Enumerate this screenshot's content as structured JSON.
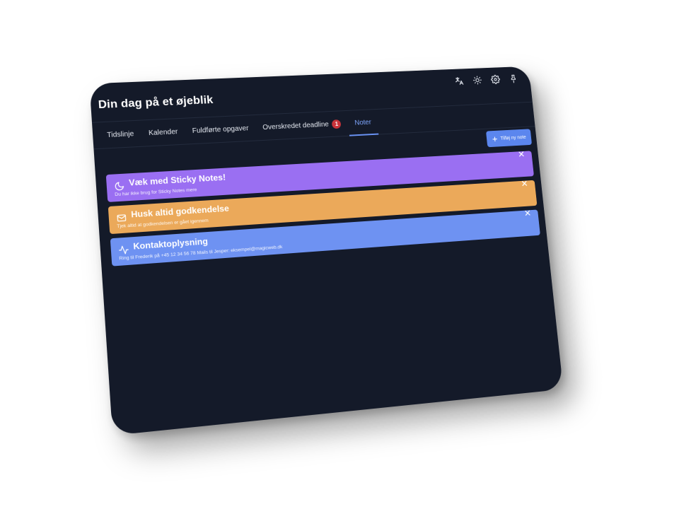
{
  "app": {
    "title": "Din dag på et øjeblik"
  },
  "header_icons": [
    {
      "name": "translate-icon"
    },
    {
      "name": "theme-toggle-icon"
    },
    {
      "name": "settings-icon"
    },
    {
      "name": "pin-icon"
    }
  ],
  "tabs": [
    {
      "label": "Tidslinje",
      "active": false
    },
    {
      "label": "Kalender",
      "active": false
    },
    {
      "label": "Fuldførte opgaver",
      "active": false
    },
    {
      "label": "Overskredet deadline",
      "active": false,
      "badge": "1"
    },
    {
      "label": "Noter",
      "active": true
    }
  ],
  "toolbar": {
    "add_note_label": "Tilføj ny note"
  },
  "notes": [
    {
      "title": "Væk med Sticky Notes!",
      "text": "Du har ikke brug for Sticky Notes mere",
      "icon": "moon-icon",
      "color": "#9a6ff2"
    },
    {
      "title": "Husk altid godkendelse",
      "text": "Tjek altid at godkendelsen er gået igennem",
      "icon": "mail-icon",
      "color": "#eba95a"
    },
    {
      "title": "Kontaktoplysning",
      "text": "Ring til Frederik på +45 12 34 56 78 Mails til Jesper: eksempel@magicweb.dk",
      "icon": "activity-icon",
      "color": "#6e92f2"
    }
  ],
  "colors": {
    "background": "#141a29",
    "accent": "#5b86ee",
    "badge": "#c8333a"
  }
}
